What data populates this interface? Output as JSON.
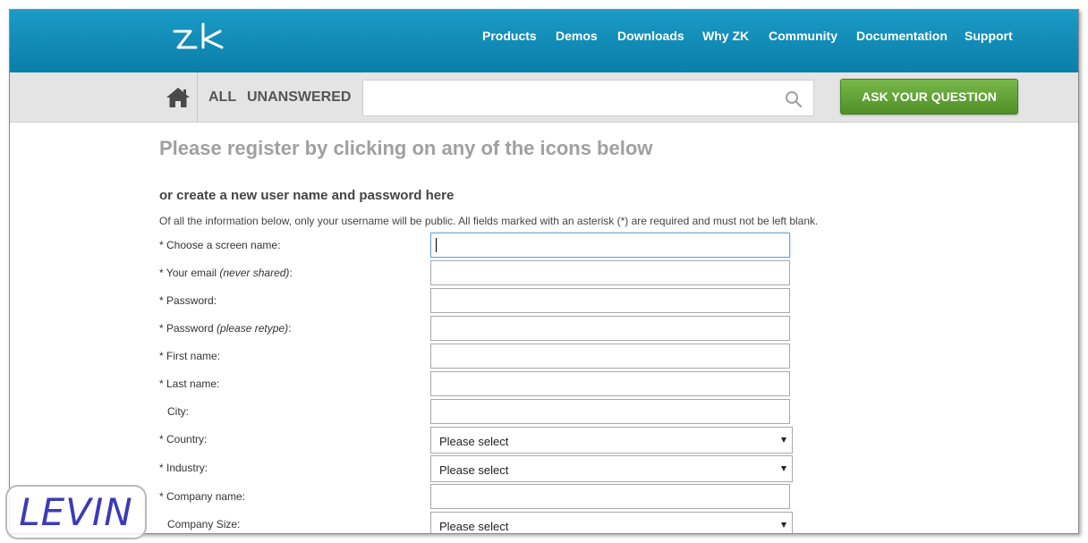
{
  "header": {
    "logo_icon": "zk-logo",
    "nav": [
      "Products",
      "Demos",
      "Downloads",
      "Why ZK",
      "Community",
      "Documentation",
      "Support"
    ]
  },
  "subbar": {
    "home_icon": "home-icon",
    "tab_all": "ALL",
    "tab_unanswered": "UNANSWERED",
    "search_placeholder": "",
    "search_icon": "search-icon",
    "ask_button": "ASK YOUR QUESTION"
  },
  "main": {
    "register_title": "Please register by clicking on any of the icons below",
    "create_heading": "or create a new user name and password here",
    "info_text": "Of all the information below, only your username will be public. All fields marked with an asterisk (*) are required and must not be left blank."
  },
  "form": {
    "screen_name": {
      "label": "* Choose a screen name:",
      "value": ""
    },
    "email": {
      "label": "* Your email ",
      "note": "(never shared)",
      "suffix": ":",
      "value": ""
    },
    "password": {
      "label": "* Password:",
      "value": ""
    },
    "password_retype": {
      "label": "* Password ",
      "note": "(please retype)",
      "suffix": ":",
      "value": ""
    },
    "first_name": {
      "label": "* First name:",
      "value": ""
    },
    "last_name": {
      "label": "* Last name:",
      "value": ""
    },
    "city": {
      "label": "City:",
      "value": ""
    },
    "country": {
      "label": "* Country:",
      "value": "Please select"
    },
    "industry": {
      "label": "* Industry:",
      "value": "Please select"
    },
    "company_name": {
      "label": "* Company name:",
      "value": ""
    },
    "company_size": {
      "label": "Company Size:",
      "value": "Please select"
    }
  },
  "watermark": {
    "text": "LEVIN"
  },
  "colors": {
    "header_blue": "#0a7ea9",
    "ask_green": "#5a9a2e",
    "title_grey": "#a0a0a0"
  }
}
